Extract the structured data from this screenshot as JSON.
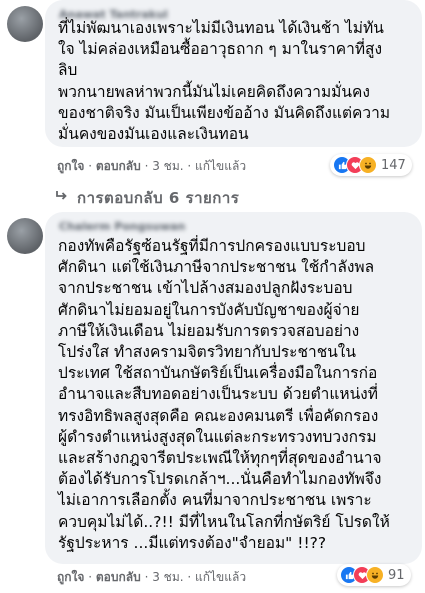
{
  "comment1": {
    "author": "Anawat Tantrakul",
    "text": "ที่ไม่พัฒนาเองเพราะไม่มีเงินทอน ได้เงินช้า ไม่ทัน\nใจ ไม่คล่องเหมือนซื้ออาวุธถาก ๆ มาในราคาที่สูง\nลิบ\nพวกนายพลห่าพวกนี้มันไม่เคยคิดถึงความมั่นคง\nของชาติจริง มันเป็นเพียงข้ออ้าง มันคิดถึงแต่ความ\nมั่นคงของมันเองและเงินทอน",
    "like_label": "ถูกใจ",
    "reply_label": "ตอบกลับ",
    "time": "3 ชม.",
    "edited": "แก้ไขแล้ว",
    "reaction_count": "147"
  },
  "replies_toggle": {
    "label": "การตอบกลับ 6 รายการ",
    "icon": "reply-arrow-icon"
  },
  "comment2": {
    "author": "Chalerm Pongsuwan",
    "text": "กองทัพคือรัฐซ้อนรัฐที่มีการปกครองแบบระบอบ\nศักดินา แต่ใช้เงินภาษีจากประชาชน ใช้กำลังพล\nจากประชาชน เข้าไปล้างสมองปลูกฝังระบอบ\nศักดินาไม่ยอมอยู่ในการบังคับบัญชาของผู้จ่าย\nภาษีให้เงินเดือน ไม่ยอมรับการตรวจสอบอย่าง\nโปร่งใส ทำสงครามจิตรวิทยากับประชาชนใน\nประเทศ ใช้สถาบันกษัตริย์เป็นเครื่องมือในการก่อ\nอำนาจและสืบทอดอย่างเป็นระบบ ด้วยตำแหน่งที่\nทรงอิทธิพลสูงสุดคือ คณะองคมนตรี เพื่อคัดกรอง\nผู้ดำรงตำแหน่งสูงสุดในแต่ละกระทรวงทบวงกรม\nและสร้างกฎจารีตประเพณีให้ทุกๆที่สุดของอำนาจ\nต้องได้รับการโปรดเกล้าฯ...นั่นคือทำไมกองทัพจึง\nไม่เอาการเลือกตั้ง คนที่มาจากประชาชน เพราะ\nควบคุมไม่ได้..?!! มีที่ไหนในโลกที่กษัตริย์ โปรดให้\nรัฐประหาร ...มีแต่ทรงต้อง\"จำยอม\" !!??",
    "like_label": "ถูกใจ",
    "reply_label": "ตอบกลับ",
    "time": "3 ชม.",
    "edited": "แก้ไขแล้ว",
    "reaction_count": "91"
  },
  "reaction_icons": [
    "like-icon",
    "love-icon",
    "haha-icon"
  ],
  "colors": {
    "bubble": "#f0f2f5",
    "meta_text": "#65676b",
    "like": "#1877f2",
    "love": "#f33e58",
    "haha": "#f7b125"
  }
}
